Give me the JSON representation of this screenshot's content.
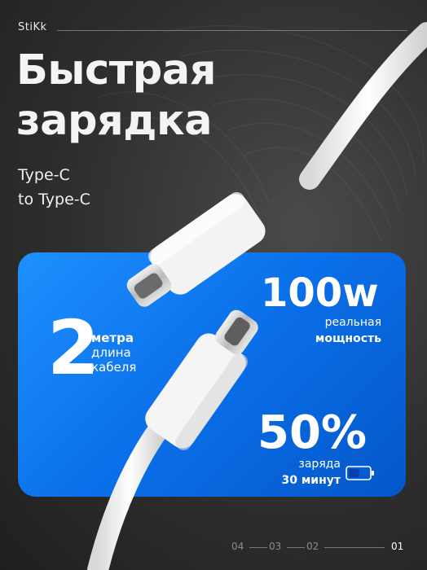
{
  "brand": "StiKk",
  "title_line1": "Быстрая",
  "title_line2": "зарядка",
  "subtitle_line1": "Type-C",
  "subtitle_line2": "to Type-C",
  "length": {
    "value": "2",
    "line1": "метра",
    "line2": "длина",
    "line3": "кабеля"
  },
  "power": {
    "value": "100w",
    "line1": "реальная",
    "line2": "мощность"
  },
  "charge": {
    "value": "50%",
    "line1": "заряда",
    "line2": "30 минут"
  },
  "pager": [
    "04",
    "03",
    "02",
    "01"
  ],
  "colors": {
    "panel": "#0a6fe8",
    "background": "#2e2e2e",
    "battery": "#0a3fb0"
  },
  "icons": [
    "battery-icon"
  ]
}
